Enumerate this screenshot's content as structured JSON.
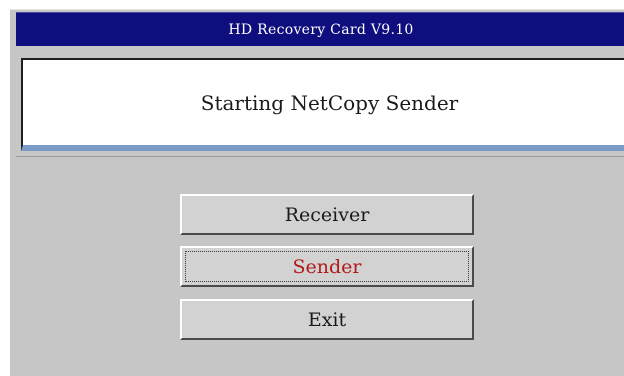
{
  "window": {
    "title": "HD Recovery Card V9.10"
  },
  "status": {
    "message": "Starting NetCopy Sender"
  },
  "buttons": {
    "receiver_label": "Receiver",
    "sender_label": "Sender",
    "exit_label": "Exit"
  },
  "colors": {
    "title_bar": "#0e0e7e",
    "window_bg": "#c6c6c6",
    "focused_label": "#b21a1a",
    "panel_underline": "#7a9cc6"
  }
}
